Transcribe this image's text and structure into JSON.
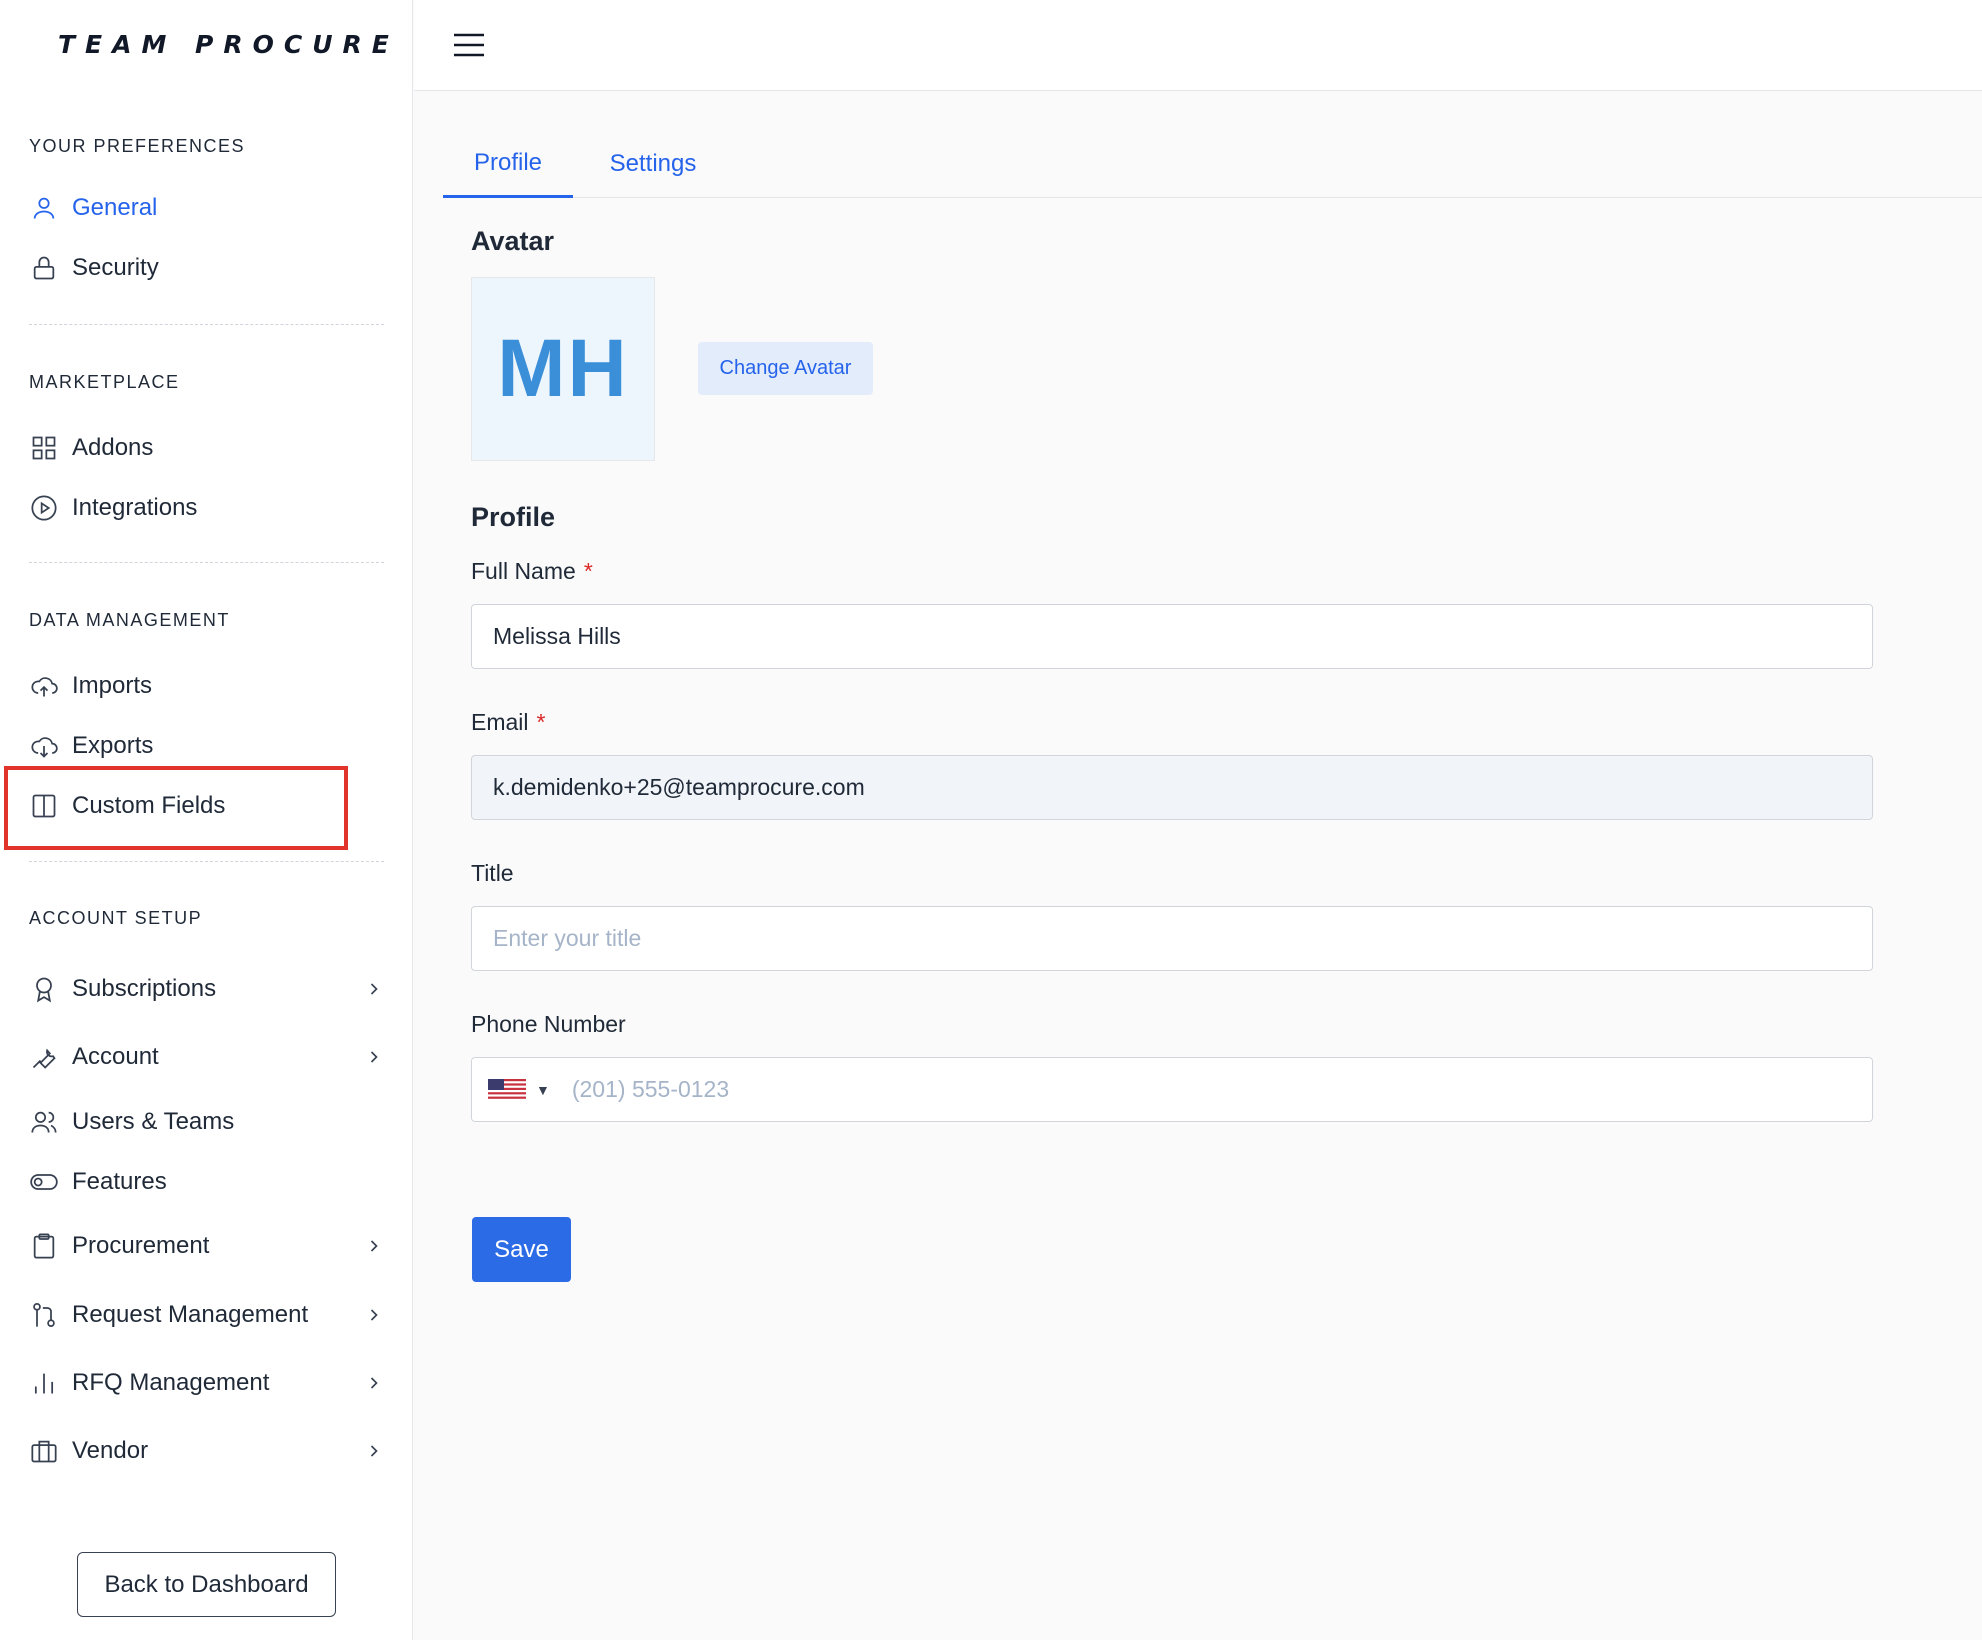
{
  "brand": {
    "logo_text": "TEAM PROCURE"
  },
  "sidebar": {
    "sections": [
      {
        "label": "YOUR PREFERENCES"
      },
      {
        "label": "MARKETPLACE"
      },
      {
        "label": "DATA MANAGEMENT"
      },
      {
        "label": "ACCOUNT SETUP"
      }
    ],
    "items": [
      {
        "label": "General",
        "icon": "user-icon",
        "active": true
      },
      {
        "label": "Security",
        "icon": "lock-icon"
      },
      {
        "label": "Addons",
        "icon": "grid-icon"
      },
      {
        "label": "Integrations",
        "icon": "play-circle-icon"
      },
      {
        "label": "Imports",
        "icon": "cloud-upload-icon"
      },
      {
        "label": "Exports",
        "icon": "cloud-download-icon"
      },
      {
        "label": "Custom Fields",
        "icon": "columns-icon",
        "highlighted": true
      },
      {
        "label": "Subscriptions",
        "icon": "award-icon",
        "expandable": true
      },
      {
        "label": "Account",
        "icon": "wrench-icon",
        "expandable": true
      },
      {
        "label": "Users & Teams",
        "icon": "users-icon"
      },
      {
        "label": "Features",
        "icon": "toggle-icon"
      },
      {
        "label": "Procurement",
        "icon": "clipboard-icon",
        "expandable": true
      },
      {
        "label": "Request Management",
        "icon": "git-pull-request-icon",
        "expandable": true
      },
      {
        "label": "RFQ Management",
        "icon": "bar-chart-icon",
        "expandable": true
      },
      {
        "label": "Vendor",
        "icon": "briefcase-icon",
        "expandable": true
      }
    ],
    "back_button": "Back to Dashboard"
  },
  "tabs": [
    {
      "label": "Profile",
      "active": true
    },
    {
      "label": "Settings"
    }
  ],
  "avatar": {
    "heading": "Avatar",
    "initials": "MH",
    "change_button": "Change Avatar"
  },
  "profile": {
    "heading": "Profile",
    "full_name": {
      "label": "Full Name",
      "required_mark": "*",
      "value": "Melissa Hills"
    },
    "email": {
      "label": "Email",
      "required_mark": "*",
      "value": "k.demidenko+25@teamprocure.com"
    },
    "title": {
      "label": "Title",
      "placeholder": "Enter your title"
    },
    "phone": {
      "label": "Phone Number",
      "country": "us-flag-icon",
      "placeholder": "(201) 555-0123"
    },
    "save_button": "Save"
  },
  "colors": {
    "accent": "#2563eb",
    "highlight_border": "#e0342b",
    "required": "#dc2626"
  }
}
